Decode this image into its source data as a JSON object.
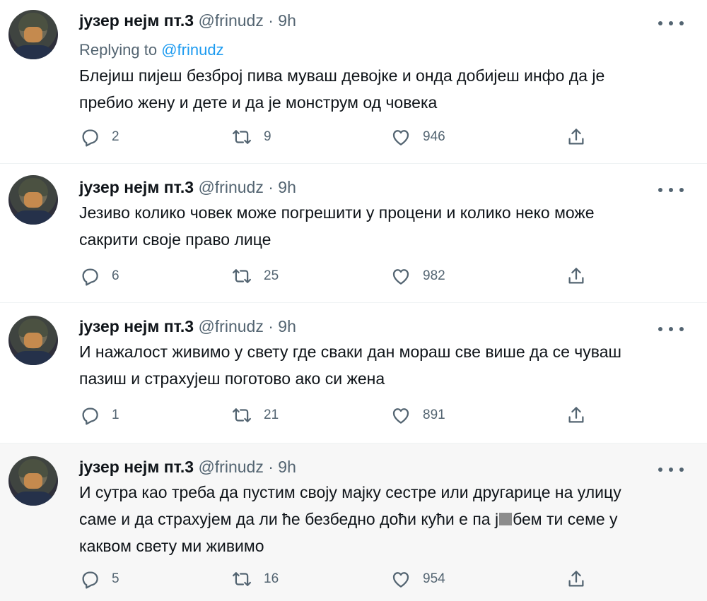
{
  "colors": {
    "text": "#0f1419",
    "secondary": "#536471",
    "link": "#1d9bf0",
    "hover_bg": "#f7f7f7"
  },
  "tweets": [
    {
      "display_name": "јузер нејм пт.3",
      "handle": "@frinudz",
      "time": "9h",
      "replying_prefix": "Replying to ",
      "replying_handle": "@frinudz",
      "lines": [
        "Блејиш пијеш безброј пива муваш девојке  и онда добијеш инфо да је",
        "пребио жену и дете и да је монструм од човека"
      ],
      "replies": "2",
      "retweets": "9",
      "likes": "946"
    },
    {
      "display_name": "јузер нејм пт.3",
      "handle": "@frinudz",
      "time": "9h",
      "lines": [
        "Језиво колико човек може погрешити у процени и колико неко може",
        "сакрити своје право лице"
      ],
      "replies": "6",
      "retweets": "25",
      "likes": "982"
    },
    {
      "display_name": "јузер нејм пт.3",
      "handle": "@frinudz",
      "time": "9h",
      "lines": [
        "И нажалост живимо у свету где сваки дан мораш све више да се чуваш",
        "пазиш и страхујеш поготово ако си жена"
      ],
      "replies": "1",
      "retweets": "21",
      "likes": "891"
    },
    {
      "display_name": "јузер нејм пт.3",
      "handle": "@frinudz",
      "time": "9h",
      "lines": [
        "И сутра као треба да пустим своју мајку сестре или другарице на улицу",
        "саме и да страхујем да ли ће безбедно доћи кући е па ј",
        "бем ти семе у",
        "каквом свету ми живимо"
      ],
      "replies": "5",
      "retweets": "16",
      "likes": "954"
    }
  ],
  "icons": {
    "reply": "reply-icon",
    "retweet": "retweet-icon",
    "like": "heart-icon",
    "share": "share-icon",
    "more": "more-icon"
  }
}
